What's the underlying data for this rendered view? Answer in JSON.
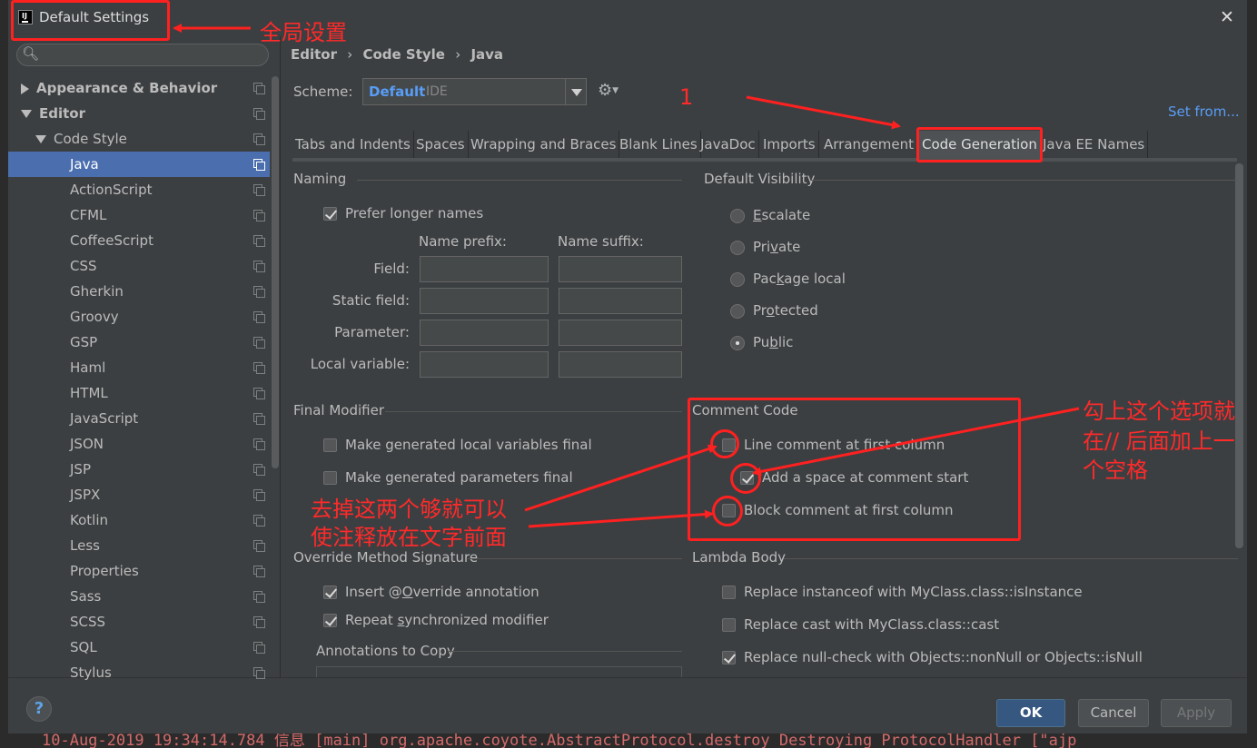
{
  "window": {
    "title": "Default Settings",
    "close": "✕"
  },
  "sidebar": {
    "search_placeholder": "",
    "items": [
      {
        "label": "Appearance & Behavior",
        "level": 0,
        "expanded": false,
        "bold": true
      },
      {
        "label": "Editor",
        "level": 0,
        "expanded": true,
        "bold": true
      },
      {
        "label": "Code Style",
        "level": 1,
        "expanded": true,
        "bold": false
      },
      {
        "label": "Java",
        "level": 2,
        "selected": true
      },
      {
        "label": "ActionScript",
        "level": 2
      },
      {
        "label": "CFML",
        "level": 2
      },
      {
        "label": "CoffeeScript",
        "level": 2
      },
      {
        "label": "CSS",
        "level": 2
      },
      {
        "label": "Gherkin",
        "level": 2
      },
      {
        "label": "Groovy",
        "level": 2
      },
      {
        "label": "GSP",
        "level": 2
      },
      {
        "label": "Haml",
        "level": 2
      },
      {
        "label": "HTML",
        "level": 2
      },
      {
        "label": "JavaScript",
        "level": 2
      },
      {
        "label": "JSON",
        "level": 2
      },
      {
        "label": "JSP",
        "level": 2
      },
      {
        "label": "JSPX",
        "level": 2
      },
      {
        "label": "Kotlin",
        "level": 2
      },
      {
        "label": "Less",
        "level": 2
      },
      {
        "label": "Properties",
        "level": 2
      },
      {
        "label": "Sass",
        "level": 2
      },
      {
        "label": "SCSS",
        "level": 2
      },
      {
        "label": "SQL",
        "level": 2
      },
      {
        "label": "Stylus",
        "level": 2
      }
    ]
  },
  "breadcrumb": {
    "items": [
      "Editor",
      "Code Style",
      "Java"
    ],
    "sep": "›"
  },
  "scheme": {
    "label": "Scheme:",
    "value": "Default",
    "suffix": "IDE",
    "set_from": "Set from..."
  },
  "tabs": [
    "Tabs and Indents",
    "Spaces",
    "Wrapping and Braces",
    "Blank Lines",
    "JavaDoc",
    "Imports",
    "Arrangement",
    "Code Generation",
    "Java EE Names"
  ],
  "active_tab": "Code Generation",
  "naming": {
    "title": "Naming",
    "prefer_longer": "Prefer longer names",
    "prefix_header": "Name prefix:",
    "suffix_header": "Name suffix:",
    "rows": [
      "Field:",
      "Static field:",
      "Parameter:",
      "Local variable:"
    ]
  },
  "visibility": {
    "title": "Default Visibility",
    "options": [
      {
        "label": "Escalate",
        "mnemonic": "E",
        "rest": "scalate"
      },
      {
        "label": "Private",
        "pre": "Pri",
        "mnemonic": "v",
        "rest": "ate"
      },
      {
        "label": "Package local",
        "pre": "Pac",
        "mnemonic": "k",
        "rest": "age local"
      },
      {
        "label": "Protected",
        "pre": "Pr",
        "mnemonic": "o",
        "rest": "tected"
      },
      {
        "label": "Public",
        "pre": "Pu",
        "mnemonic": "b",
        "rest": "lic"
      }
    ],
    "selected": "Public"
  },
  "final_modifier": {
    "title": "Final Modifier",
    "local_vars": "Make generated local variables final",
    "params": "Make generated parameters final"
  },
  "comment_code": {
    "title": "Comment Code",
    "line_first_col": "Line comment at first column",
    "add_space": "Add a space at comment start",
    "block_first_col": "Block comment at first column"
  },
  "override": {
    "title": "Override Method Signature",
    "insert_override_pre": "Insert @",
    "insert_override_mn": "O",
    "insert_override_rest": "verride annotation",
    "repeat_sync_pre": "Repeat ",
    "repeat_sync_mn": "s",
    "repeat_sync_rest": "ynchronized modifier",
    "annotations_title": "Annotations to Copy"
  },
  "lambda": {
    "title": "Lambda Body",
    "instanceof": "Replace instanceof with MyClass.class::isInstance",
    "cast": "Replace cast with MyClass.class::cast",
    "nullcheck": "Replace null-check with Objects::nonNull or Objects::isNull"
  },
  "footer": {
    "help": "?",
    "ok": "OK",
    "cancel": "Cancel",
    "apply": "Apply"
  },
  "log_line": "10-Aug-2019 19:34:14.784 信息 [main] org.apache.coyote.AbstractProtocol.destroy Destroying ProtocolHandler [\"ajp",
  "annotations": {
    "global": "全局设置",
    "step_one": "1",
    "remove_two": "去掉这两个够就可以",
    "remove_two_2": "使注释放在文字前面",
    "check_this": "勾上这个选项就",
    "check_this_2": "在// 后面加上一",
    "check_this_3": "个空格"
  },
  "colors": {
    "accent": "#4b6eaf",
    "link": "#589df6",
    "annotation": "#ff2020",
    "primary_btn": "#365880"
  }
}
